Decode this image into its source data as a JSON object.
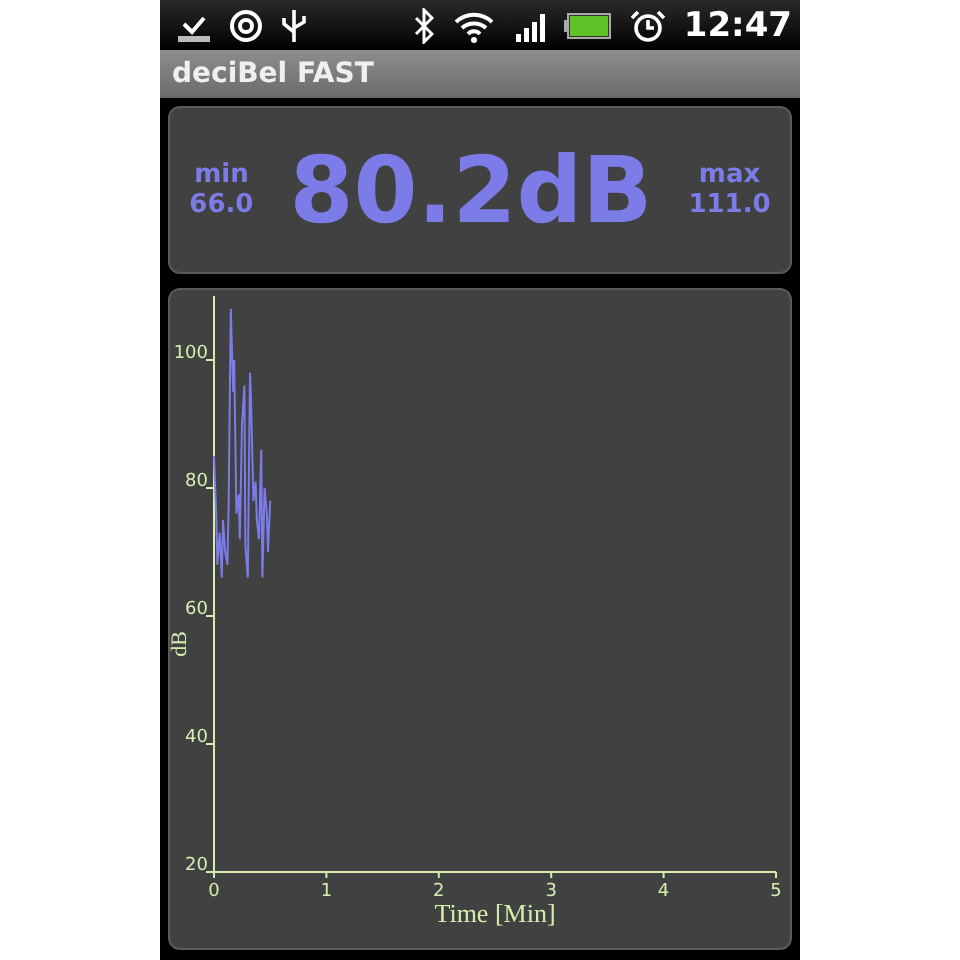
{
  "status_bar": {
    "time": "12:47"
  },
  "window": {
    "title": "deciBel FAST"
  },
  "meter": {
    "min_label": "min",
    "min_value": "66.0",
    "reading": "80.2dB",
    "max_label": "max",
    "max_value": "111.0"
  },
  "graph": {
    "chart_data": {
      "type": "line",
      "xlabel": "Time [Min]",
      "ylabel": "dB",
      "xlim": [
        0,
        5
      ],
      "ylim": [
        20,
        110
      ],
      "xticks": [
        0,
        1,
        2,
        3,
        4,
        5
      ],
      "yticks": [
        20,
        40,
        60,
        80,
        100
      ],
      "x": [
        0,
        0.02,
        0.03,
        0.05,
        0.07,
        0.08,
        0.1,
        0.12,
        0.13,
        0.15,
        0.17,
        0.18,
        0.2,
        0.22,
        0.23,
        0.25,
        0.27,
        0.28,
        0.3,
        0.32,
        0.33,
        0.35,
        0.37,
        0.38,
        0.4,
        0.42,
        0.43,
        0.45,
        0.47,
        0.48,
        0.5
      ],
      "series": [
        {
          "color": "#7b7bea",
          "values": [
            85,
            76,
            68,
            73,
            66,
            75,
            70,
            68,
            77,
            108,
            95,
            100,
            76,
            79,
            72,
            90,
            96,
            71,
            66,
            98,
            94,
            78,
            81,
            75,
            72,
            86,
            66,
            80,
            76,
            70,
            78
          ]
        }
      ]
    }
  }
}
